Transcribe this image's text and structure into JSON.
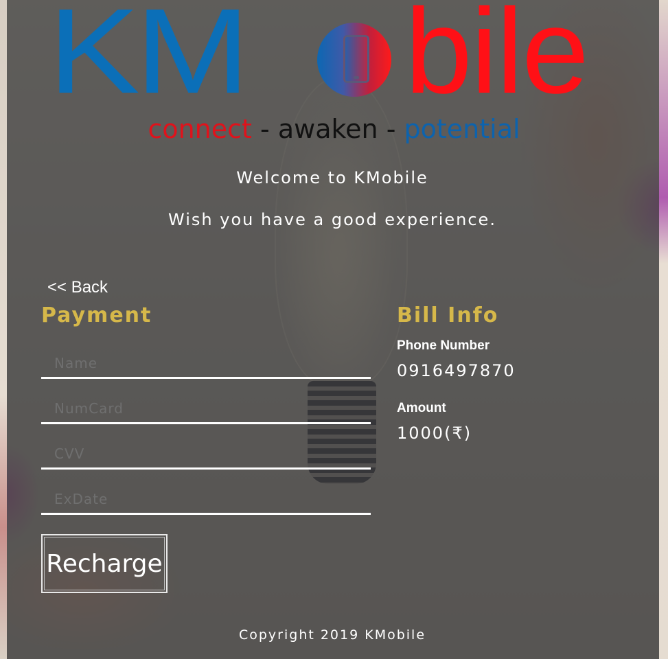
{
  "brand": {
    "logo_text_blue": "KM",
    "logo_text_red": "bile",
    "tagline": {
      "part1": "connect",
      "part2": "awaken",
      "part3": "potential",
      "separator": "-"
    },
    "colors": {
      "blue": "#0b6fb8",
      "red": "#ff1016",
      "gold": "#d6b84a"
    }
  },
  "welcome": "Welcome to KMobile",
  "wish": "Wish you have a good experience.",
  "nav": {
    "back_label": "<< Back"
  },
  "payment": {
    "title": "Payment",
    "fields": [
      {
        "placeholder": "Name",
        "value": ""
      },
      {
        "placeholder": "NumCard",
        "value": ""
      },
      {
        "placeholder": "CVV",
        "value": ""
      },
      {
        "placeholder": "ExDate",
        "value": ""
      }
    ],
    "submit_label": "Recharge"
  },
  "bill": {
    "title": "Bill Info",
    "phone_label": "Phone Number",
    "phone_value": "0916497870",
    "amount_label": "Amount",
    "amount_value": "1000(₹)"
  },
  "footer": {
    "copyright": "Copyright 2019 KMobile"
  },
  "icons": {
    "logo_o": "mobile-phone-icon"
  }
}
